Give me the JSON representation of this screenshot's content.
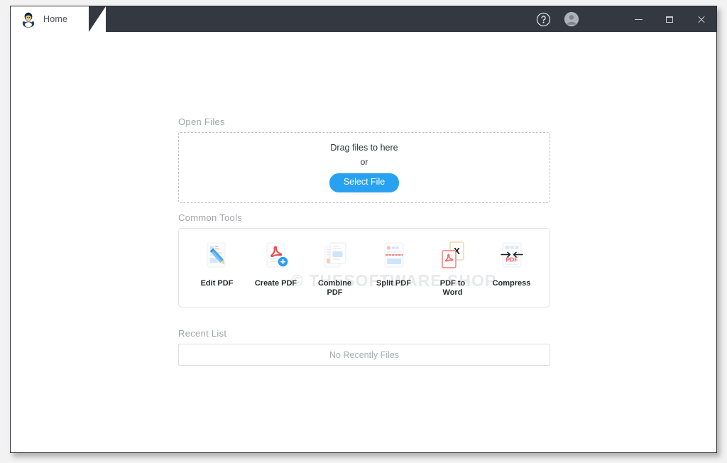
{
  "window": {
    "tab": {
      "label": "Home",
      "icon": "penguin-logo"
    },
    "titlebar_actions": [
      {
        "name": "help-icon",
        "label": "Help"
      },
      {
        "name": "account-avatar-icon",
        "label": "Account"
      }
    ],
    "controls": [
      {
        "name": "minimize-button",
        "label": "Minimize"
      },
      {
        "name": "maximize-button",
        "label": "Maximize"
      },
      {
        "name": "close-button",
        "label": "Close"
      }
    ],
    "colors": {
      "titlebar": "#343841",
      "accent": "#29a1f2",
      "label_gray": "#a0a4ab",
      "body": "#ffffff"
    }
  },
  "open_files": {
    "section_label": "Open Files",
    "drag_text": "Drag files to here",
    "or_text": "or",
    "button_label": "Select File"
  },
  "common_tools": {
    "section_label": "Common Tools",
    "items": [
      {
        "label": "Edit PDF",
        "icon": "edit-pdf-icon"
      },
      {
        "label": "Create PDF",
        "icon": "create-pdf-icon"
      },
      {
        "label": "Combine\nPDF",
        "label_line1": "Combine",
        "label_line2": "PDF",
        "icon": "combine-pdf-icon"
      },
      {
        "label": "Split PDF",
        "icon": "split-pdf-icon"
      },
      {
        "label": "PDF to\nWord",
        "label_line1": "PDF to",
        "label_line2": "Word",
        "icon": "pdf-to-word-icon"
      },
      {
        "label": "Compress",
        "icon": "compress-pdf-icon"
      }
    ]
  },
  "recent_list": {
    "section_label": "Recent List",
    "empty_text": "No Recently Files",
    "items": []
  },
  "watermark": {
    "text": "© THESOFTWARE SHOP"
  }
}
